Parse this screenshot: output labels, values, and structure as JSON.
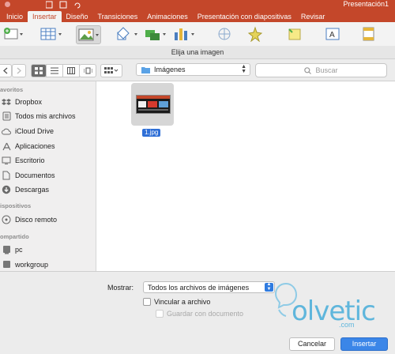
{
  "app": {
    "document_title": "Presentación1",
    "tabs": [
      "Inicio",
      "Insertar",
      "Diseño",
      "Transiciones",
      "Animaciones",
      "Presentación con diapositivas",
      "Revisar"
    ],
    "active_tab": "Insertar",
    "colors": {
      "chrome": "#c4472a",
      "accent": "#3b86e8"
    }
  },
  "dialog": {
    "title": "Elija una imagen",
    "location": "Imágenes",
    "search_placeholder": "Buscar",
    "sidebar": {
      "favorites_header": "avoritos",
      "favorites": [
        {
          "label": "Dropbox",
          "icon": "dropbox-icon"
        },
        {
          "label": "Todos mis archivos",
          "icon": "all-files-icon"
        },
        {
          "label": "iCloud Drive",
          "icon": "cloud-icon"
        },
        {
          "label": "Aplicaciones",
          "icon": "applications-icon"
        },
        {
          "label": "Escritorio",
          "icon": "desktop-icon"
        },
        {
          "label": "Documentos",
          "icon": "documents-icon"
        },
        {
          "label": "Descargas",
          "icon": "downloads-icon"
        }
      ],
      "devices_header": "ispositivos",
      "devices": [
        {
          "label": "Disco remoto",
          "icon": "disc-icon"
        }
      ],
      "shared_header": "ompartido",
      "shared": [
        {
          "label": "pc",
          "icon": "computer-icon"
        },
        {
          "label": "workgroup",
          "icon": "network-icon"
        }
      ]
    },
    "files": [
      {
        "name": "1.jpg",
        "selected": true
      }
    ],
    "show_label": "Mostrar:",
    "show_value": "Todos los archivos de imágenes",
    "link_checkbox": "Vincular a archivo",
    "save_checkbox": "Guardar con documento",
    "cancel_label": "Cancelar",
    "insert_label": "Insertar"
  },
  "watermark": {
    "text": "olvetic",
    "sub": ".com"
  }
}
